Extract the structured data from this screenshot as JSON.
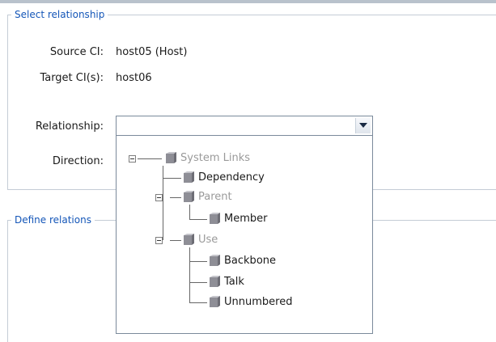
{
  "select_section": {
    "legend": "Select relationship",
    "source_ci_label": "Source CI:",
    "source_ci_value": "host05 (Host)",
    "target_ci_label": "Target CI(s):",
    "target_ci_value": "host06",
    "relationship_label": "Relationship:",
    "relationship_value": "",
    "direction_label": "Direction:"
  },
  "define_section": {
    "legend": "Define relations"
  },
  "tree": {
    "root": {
      "label": "System Links",
      "expanded": true,
      "icon": "cube-icon"
    },
    "items": [
      {
        "label": "Dependency",
        "selectable": true
      },
      {
        "label": "Parent",
        "selectable": false,
        "expanded": true
      },
      {
        "label": "Member",
        "selectable": true
      },
      {
        "label": "Use",
        "selectable": false,
        "expanded": true
      },
      {
        "label": "Backbone",
        "selectable": true
      },
      {
        "label": "Talk",
        "selectable": true
      },
      {
        "label": "Unnumbered",
        "selectable": true
      }
    ]
  },
  "colors": {
    "legend_text": "#1456b8",
    "border": "#c4ccd6",
    "category_text": "#9a9a9a",
    "cube": "#8e8e96"
  }
}
